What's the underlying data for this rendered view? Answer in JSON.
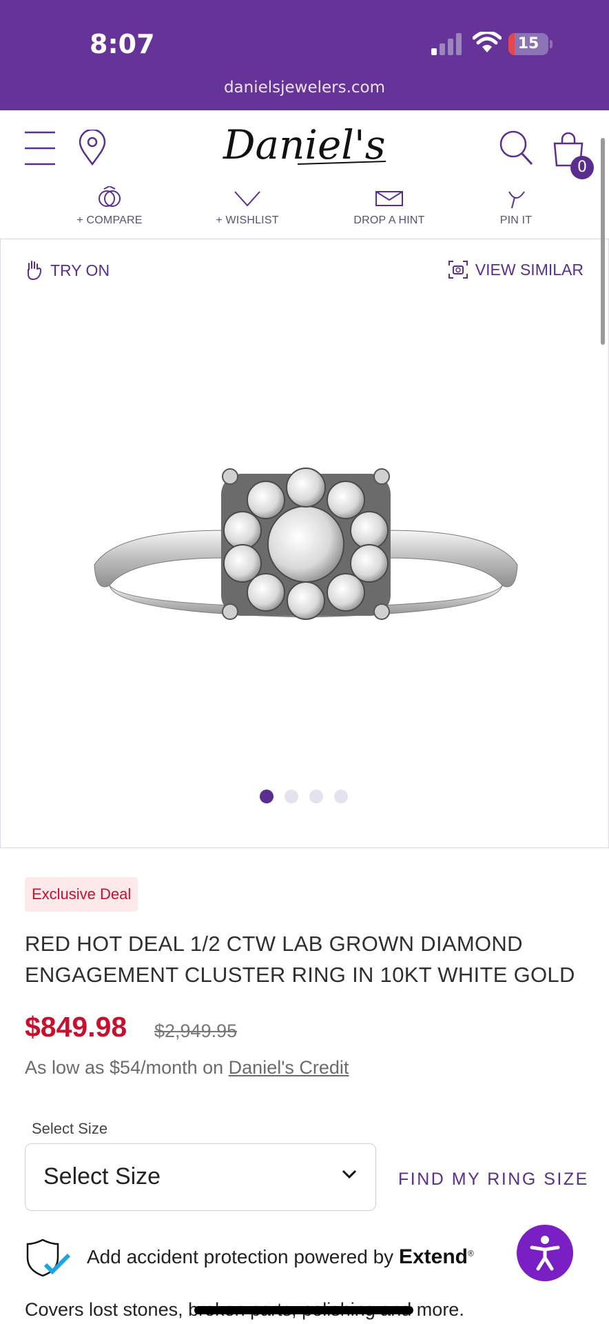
{
  "status_bar": {
    "time": "8:07",
    "url": "danielsjewelers.com",
    "battery": "15",
    "battery_level": 0.15
  },
  "header": {
    "logo": "Daniel's",
    "cart_count": "0"
  },
  "actions": [
    {
      "label": "+ COMPARE",
      "icon": "compare-icon"
    },
    {
      "label": "+ WISHLIST",
      "icon": "heart-icon"
    },
    {
      "label": "DROP A HINT",
      "icon": "envelope-icon"
    },
    {
      "label": "PIN IT",
      "icon": "pinterest-icon"
    }
  ],
  "gallery": {
    "try_on": "TRY ON",
    "view_similar": "VIEW SIMILAR",
    "dots": 4,
    "active_dot": 1
  },
  "product": {
    "badge": "Exclusive Deal",
    "title": "RED HOT DEAL 1/2 CTW LAB GROWN DIAMOND ENGAGEMENT CLUSTER RING IN 10KT WHITE GOLD",
    "price": "$849.98",
    "old_price": "$2,949.95",
    "credit_text": "As low as $54/month on ",
    "credit_link": "Daniel's Credit"
  },
  "size": {
    "label": "Select Size",
    "value": "Select Size",
    "find_link": "FIND MY RING SIZE"
  },
  "protection": {
    "text": "Add accident protection powered by ",
    "brand": "Extend",
    "covers": "Covers lost stones, broken parts, polishing and more."
  },
  "colors": {
    "brand": "#663399",
    "accent": "#5b2d91",
    "sale": "#c8102e",
    "accessibility": "#7a1fc4"
  }
}
